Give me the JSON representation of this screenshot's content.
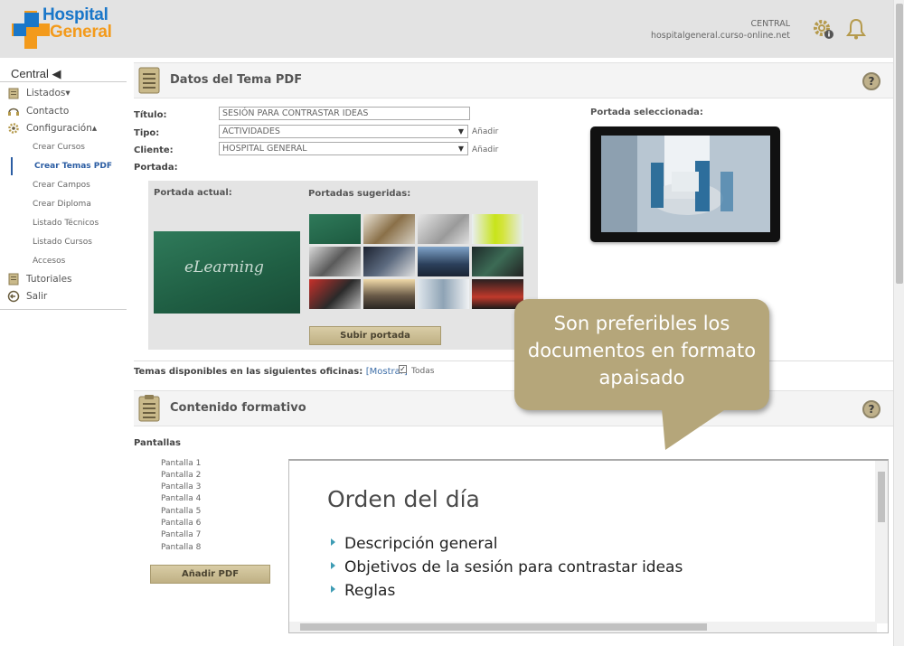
{
  "header": {
    "logo_line1": "Hospital",
    "logo_line2": "General",
    "center_name": "CENTRAL",
    "center_url": "hospitalgeneral.curso-online.net",
    "icons": [
      "gear-info-icon",
      "bell-icon"
    ],
    "brand_blue": "#1a77c9",
    "brand_orange": "#f39a1b"
  },
  "sidebar": {
    "title": "Central ◀",
    "items": [
      {
        "label": "Listados▾",
        "icon": "clipboard-icon"
      },
      {
        "label": "Contacto",
        "icon": "headset-icon"
      },
      {
        "label": "Configuración▴",
        "icon": "gear-icon"
      },
      {
        "label": "Tutoriales",
        "icon": "book-icon"
      },
      {
        "label": "Salir",
        "icon": "exit-icon"
      }
    ],
    "subitems": [
      "Crear Cursos",
      "Crear Temas PDF",
      "Crear Campos",
      "Crear Diploma",
      "Listado Técnicos",
      "Listado Cursos",
      "Accesos"
    ],
    "active_subitem": "Crear Temas PDF"
  },
  "panel1": {
    "title": "Datos del Tema PDF",
    "labels": {
      "titulo": "Título:",
      "tipo": "Tipo:",
      "cliente": "Cliente:",
      "portada": "Portada:"
    },
    "titulo_value": "SESIÓN PARA CONTRASTAR IDEAS",
    "tipo_value": "ACTIVIDADES",
    "cliente_value": "HOSPITAL GENERAL",
    "add_label": "Añadir",
    "portada_actual_label": "Portada actual:",
    "portada_actual_text": "eLearning",
    "portadas_sugeridas_label": "Portadas sugeridas:",
    "subir_button": "Subir portada",
    "portada_seleccionada_label": "Portada seleccionada:"
  },
  "oficinas": {
    "text": "Temas disponibles en las siguientes oficinas:",
    "link": "[Mostrar]",
    "todas_label": "Todas",
    "todas_checked": true
  },
  "panel2": {
    "title": "Contenido formativo",
    "pantallas_label": "Pantallas",
    "pantallas": [
      "Pantalla 1",
      "Pantalla 2",
      "Pantalla 3",
      "Pantalla 4",
      "Pantalla 5",
      "Pantalla 6",
      "Pantalla 7",
      "Pantalla 8"
    ],
    "add_pdf_button": "Añadir PDF"
  },
  "preview": {
    "heading": "Orden del día",
    "bullets": [
      "Descripción general",
      "Objetivos de la sesión para contrastar ideas",
      "Reglas"
    ]
  },
  "callout": {
    "lines": [
      "Son preferibles los",
      "documentos en formato",
      "apaisado"
    ],
    "color": "#b5a67a"
  }
}
